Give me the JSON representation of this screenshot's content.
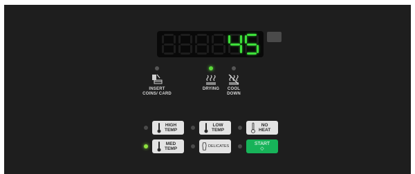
{
  "display": {
    "value": "45",
    "colors": {
      "lit": "#3de03a",
      "unlit": "#1d1d1d",
      "background": "#090909"
    }
  },
  "indicators": [
    {
      "id": "insert-coins",
      "label_line1": "INSERT",
      "label_line2": "COINS/ CARD",
      "active": false,
      "icon": "coin-card-icon"
    },
    {
      "id": "drying",
      "label_line1": "DRYING",
      "label_line2": "",
      "active": true,
      "icon": "heat-waves-icon"
    },
    {
      "id": "cool-down",
      "label_line1": "COOL",
      "label_line2": "DOWN",
      "active": false,
      "icon": "cool-down-icon"
    }
  ],
  "buttons": {
    "high_temp": {
      "line1": "HIGH",
      "line2": "TEMP",
      "led_on": false
    },
    "low_temp": {
      "line1": "LOW",
      "line2": "TEMP",
      "led_on": false
    },
    "no_heat": {
      "line1": "NO",
      "line2": "HEAT",
      "led_on": false
    },
    "med_temp": {
      "line1": "MED",
      "line2": "TEMP",
      "led_on": true
    },
    "delicates": {
      "line1": "DELICATES",
      "led_on": false
    },
    "start": {
      "label": "START",
      "symbol": "◇",
      "led_on": false
    }
  },
  "colors": {
    "panel": "#1e1e1e",
    "button_face": "#e3e3e3",
    "start_button": "#17b359",
    "led_on": "#8ee23f",
    "led_off": "#4a4a4a"
  }
}
